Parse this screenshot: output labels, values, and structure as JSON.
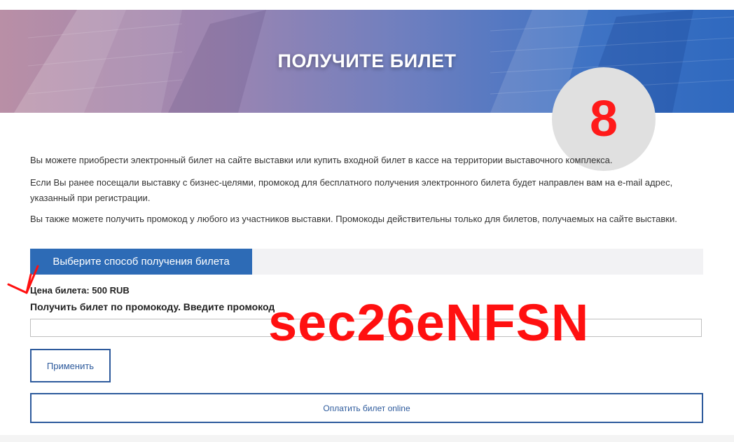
{
  "hero": {
    "title": "ПОЛУЧИТЕ БИЛЕТ"
  },
  "badge": {
    "number": "8"
  },
  "intro": {
    "p1": "Вы можете приобрести электронный билет на сайте выставки или купить входной билет в кассе на территории выставочного комплекса.",
    "p2": "Если Вы ранее посещали выставку с бизнес-целями, промокод для бесплатного получения электронного билета будет направлен вам на e-mail адрес, указанный при регистрации.",
    "p3": "Вы также можете получить промокод у любого из участников выставки. Промокоды действительны только для билетов, получаемых на сайте выставки."
  },
  "method": {
    "tab_label": "Выберите способ получения билета"
  },
  "ticket": {
    "price_label": "Цена билета: 500 RUB",
    "promo_label": "Получить билет по промокоду. Введите промокод",
    "promo_value": "",
    "promo_overlay": "sec26eNFSN",
    "apply_label": "Применить",
    "pay_label": "Оплатить билет online"
  },
  "colors": {
    "accent": "#2d6bb6",
    "border": "#2d5a9c",
    "highlight": "#ff1010"
  }
}
